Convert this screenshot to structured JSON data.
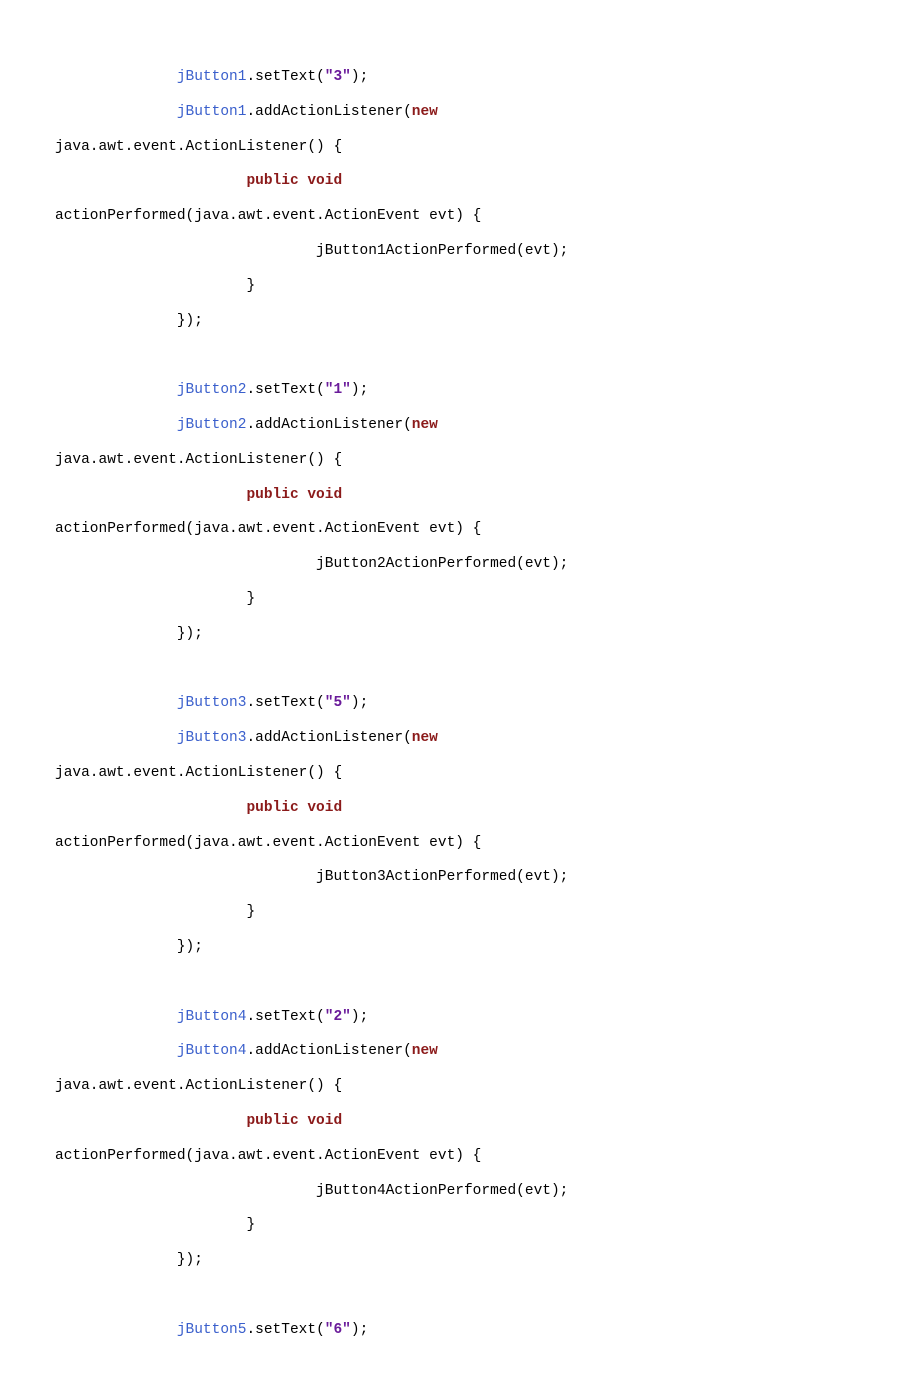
{
  "colors": {
    "identifier": "#3a5fcc",
    "string": "#6a1b9a",
    "keyword": "#8b1a1a",
    "text": "#000000"
  },
  "code": [
    {
      "indent": 14,
      "spans": [
        {
          "cls": "blue",
          "t": "jButton1"
        },
        {
          "cls": "",
          "t": ".setText("
        },
        {
          "cls": "purple",
          "t": "\"3\""
        },
        {
          "cls": "",
          "t": ");"
        }
      ]
    },
    {
      "indent": 14,
      "spans": [
        {
          "cls": "blue",
          "t": "jButton1"
        },
        {
          "cls": "",
          "t": ".addActionListener("
        },
        {
          "cls": "maroon",
          "t": "new"
        }
      ]
    },
    {
      "indent": 0,
      "spans": [
        {
          "cls": "",
          "t": "java.awt.event.ActionListener() {"
        }
      ]
    },
    {
      "indent": 22,
      "spans": [
        {
          "cls": "maroon",
          "t": "public void"
        }
      ]
    },
    {
      "indent": 0,
      "spans": [
        {
          "cls": "",
          "t": "actionPerformed(java.awt.event.ActionEvent evt) {"
        }
      ]
    },
    {
      "indent": 30,
      "spans": [
        {
          "cls": "",
          "t": "jButton1ActionPerformed(evt);"
        }
      ]
    },
    {
      "indent": 22,
      "spans": [
        {
          "cls": "",
          "t": "}"
        }
      ]
    },
    {
      "indent": 14,
      "spans": [
        {
          "cls": "",
          "t": "});"
        }
      ]
    },
    {
      "blank": true
    },
    {
      "indent": 14,
      "spans": [
        {
          "cls": "blue",
          "t": "jButton2"
        },
        {
          "cls": "",
          "t": ".setText("
        },
        {
          "cls": "purple",
          "t": "\"1\""
        },
        {
          "cls": "",
          "t": ");"
        }
      ]
    },
    {
      "indent": 14,
      "spans": [
        {
          "cls": "blue",
          "t": "jButton2"
        },
        {
          "cls": "",
          "t": ".addActionListener("
        },
        {
          "cls": "maroon",
          "t": "new"
        }
      ]
    },
    {
      "indent": 0,
      "spans": [
        {
          "cls": "",
          "t": "java.awt.event.ActionListener() {"
        }
      ]
    },
    {
      "indent": 22,
      "spans": [
        {
          "cls": "maroon",
          "t": "public void"
        }
      ]
    },
    {
      "indent": 0,
      "spans": [
        {
          "cls": "",
          "t": "actionPerformed(java.awt.event.ActionEvent evt) {"
        }
      ]
    },
    {
      "indent": 30,
      "spans": [
        {
          "cls": "",
          "t": "jButton2ActionPerformed(evt);"
        }
      ]
    },
    {
      "indent": 22,
      "spans": [
        {
          "cls": "",
          "t": "}"
        }
      ]
    },
    {
      "indent": 14,
      "spans": [
        {
          "cls": "",
          "t": "});"
        }
      ]
    },
    {
      "blank": true
    },
    {
      "indent": 14,
      "spans": [
        {
          "cls": "blue",
          "t": "jButton3"
        },
        {
          "cls": "",
          "t": ".setText("
        },
        {
          "cls": "purple",
          "t": "\"5\""
        },
        {
          "cls": "",
          "t": ");"
        }
      ]
    },
    {
      "indent": 14,
      "spans": [
        {
          "cls": "blue",
          "t": "jButton3"
        },
        {
          "cls": "",
          "t": ".addActionListener("
        },
        {
          "cls": "maroon",
          "t": "new"
        }
      ]
    },
    {
      "indent": 0,
      "spans": [
        {
          "cls": "",
          "t": "java.awt.event.ActionListener() {"
        }
      ]
    },
    {
      "indent": 22,
      "spans": [
        {
          "cls": "maroon",
          "t": "public void"
        }
      ]
    },
    {
      "indent": 0,
      "spans": [
        {
          "cls": "",
          "t": "actionPerformed(java.awt.event.ActionEvent evt) {"
        }
      ]
    },
    {
      "indent": 30,
      "spans": [
        {
          "cls": "",
          "t": "jButton3ActionPerformed(evt);"
        }
      ]
    },
    {
      "indent": 22,
      "spans": [
        {
          "cls": "",
          "t": "}"
        }
      ]
    },
    {
      "indent": 14,
      "spans": [
        {
          "cls": "",
          "t": "});"
        }
      ]
    },
    {
      "blank": true
    },
    {
      "indent": 14,
      "spans": [
        {
          "cls": "blue",
          "t": "jButton4"
        },
        {
          "cls": "",
          "t": ".setText("
        },
        {
          "cls": "purple",
          "t": "\"2\""
        },
        {
          "cls": "",
          "t": ");"
        }
      ]
    },
    {
      "indent": 14,
      "spans": [
        {
          "cls": "blue",
          "t": "jButton4"
        },
        {
          "cls": "",
          "t": ".addActionListener("
        },
        {
          "cls": "maroon",
          "t": "new"
        }
      ]
    },
    {
      "indent": 0,
      "spans": [
        {
          "cls": "",
          "t": "java.awt.event.ActionListener() {"
        }
      ]
    },
    {
      "indent": 22,
      "spans": [
        {
          "cls": "maroon",
          "t": "public void"
        }
      ]
    },
    {
      "indent": 0,
      "spans": [
        {
          "cls": "",
          "t": "actionPerformed(java.awt.event.ActionEvent evt) {"
        }
      ]
    },
    {
      "indent": 30,
      "spans": [
        {
          "cls": "",
          "t": "jButton4ActionPerformed(evt);"
        }
      ]
    },
    {
      "indent": 22,
      "spans": [
        {
          "cls": "",
          "t": "}"
        }
      ]
    },
    {
      "indent": 14,
      "spans": [
        {
          "cls": "",
          "t": "});"
        }
      ]
    },
    {
      "blank": true
    },
    {
      "indent": 14,
      "spans": [
        {
          "cls": "blue",
          "t": "jButton5"
        },
        {
          "cls": "",
          "t": ".setText("
        },
        {
          "cls": "purple",
          "t": "\"6\""
        },
        {
          "cls": "",
          "t": ");"
        }
      ]
    }
  ]
}
